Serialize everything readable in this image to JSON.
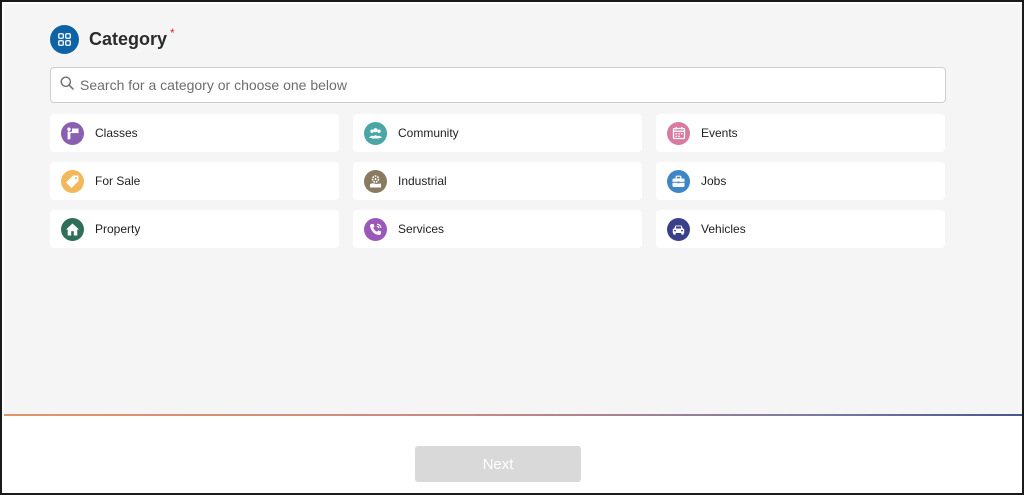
{
  "header": {
    "title": "Category",
    "required_mark": "*"
  },
  "search": {
    "placeholder": "Search for a category or choose one below"
  },
  "categories": [
    {
      "label": "Classes",
      "icon": "presentation-icon",
      "color": "#8a5fb0"
    },
    {
      "label": "Community",
      "icon": "people-icon",
      "color": "#4aa5a5"
    },
    {
      "label": "Events",
      "icon": "calendar-icon",
      "color": "#d97aa0"
    },
    {
      "label": "For Sale",
      "icon": "tag-icon",
      "color": "#f2b85c"
    },
    {
      "label": "Industrial",
      "icon": "factory-icon",
      "color": "#8a7a62"
    },
    {
      "label": "Jobs",
      "icon": "briefcase-icon",
      "color": "#3e86c5"
    },
    {
      "label": "Property",
      "icon": "house-icon",
      "color": "#2f6e58"
    },
    {
      "label": "Services",
      "icon": "phone-icon",
      "color": "#9a58b8"
    },
    {
      "label": "Vehicles",
      "icon": "car-icon",
      "color": "#3a3f8a"
    }
  ],
  "footer": {
    "next_label": "Next"
  },
  "colors": {
    "accent": "#0d63a5",
    "required": "#d9302c",
    "disabled_button": "#d9d9d9"
  }
}
